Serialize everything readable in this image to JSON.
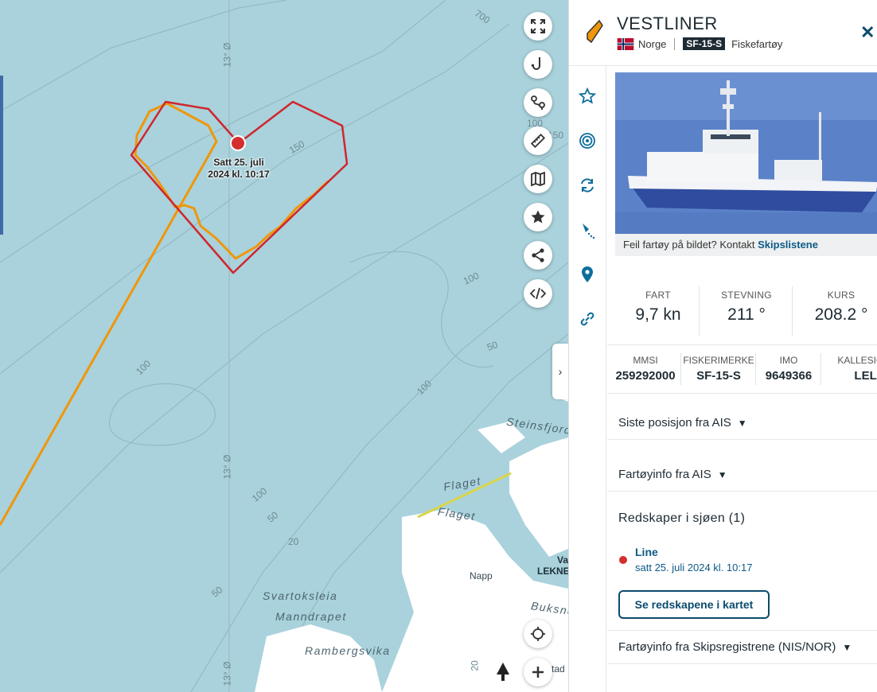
{
  "map": {
    "depth_labels": [
      "700",
      "150",
      "100",
      "150",
      "100",
      "50",
      "100",
      "100",
      "100",
      "50",
      "20",
      "50",
      "20"
    ],
    "meridian_labels": [
      "13° Ø",
      "13° Ø",
      "13° Ø"
    ],
    "place_names": {
      "steinsfjorden": "Steinsfjorde",
      "flaget_1": "Flaget",
      "flaget_2": "Flaget",
      "svartoksleia": "Svartoksleia",
      "manndrapet": "Manndrapet",
      "rambergsvika": "Rambergsvika",
      "napp": "Napp",
      "buksnes": "Buksne",
      "leknes": "LEKNE",
      "va": "Va",
      "stad": "tad"
    },
    "marker": {
      "line1": "Satt 25. juli",
      "line2": "2024 kl. 10:17",
      "color": "#d32f2f"
    },
    "colors": {
      "sea": "#a9d2dc",
      "land": "#ffffff",
      "track": "#f0960a",
      "heart": "#d0262d",
      "ferry": "#d9d44a"
    },
    "controls": [
      {
        "name": "fullscreen-icon"
      },
      {
        "name": "fishing-hook-icon"
      },
      {
        "name": "route-icon"
      },
      {
        "name": "ruler-icon"
      },
      {
        "name": "map-layers-icon"
      },
      {
        "name": "star-icon"
      },
      {
        "name": "share-icon"
      },
      {
        "name": "embed-code-icon"
      }
    ]
  },
  "vessel": {
    "name": "VESTLINER",
    "country": "Norge",
    "registration": "SF-15-S",
    "type": "Fiskefartøy",
    "photo_caption": "Feil fartøy på bildet? Kontakt",
    "photo_caption_link": "Skipslistene",
    "stats": [
      {
        "label": "FART",
        "value": "9,7 kn"
      },
      {
        "label": "STEVNING",
        "value": "211 °"
      },
      {
        "label": "KURS",
        "value": "208.2 °"
      }
    ],
    "ids": [
      {
        "label": "MMSI",
        "value": "259292000"
      },
      {
        "label": "FISKERIMERKE",
        "value": "SF-15-S"
      },
      {
        "label": "IMO",
        "value": "9649366"
      },
      {
        "label": "KALLESIGNAL",
        "value": "LELD"
      }
    ]
  },
  "sections": {
    "last_position": "Siste posisjon fra AIS",
    "vessel_info_ais": "Fartøyinfo fra AIS",
    "gear_title": "Redskaper i sjøen (1)",
    "gear_item_name": "Line",
    "gear_item_date": "satt 25. juli 2024 kl. 10:17",
    "gear_button": "Se redskapene i kartet",
    "registry_info": "Fartøyinfo fra Skipsregistrene (NIS/NOR)"
  }
}
